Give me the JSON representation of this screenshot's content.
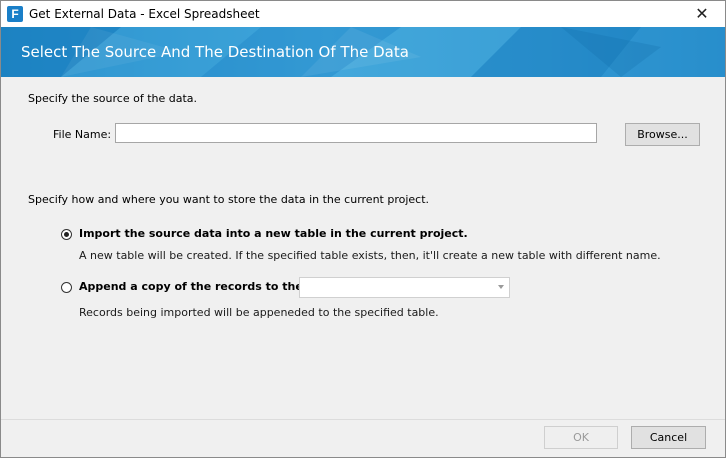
{
  "window": {
    "title": "Get External Data - Excel Spreadsheet",
    "app_icon_letter": "F",
    "close_glyph": "✕"
  },
  "banner": {
    "title": "Select The Source And The Destination Of The Data",
    "color": "#2a90cd"
  },
  "source": {
    "prompt": "Specify the source of the data.",
    "file_label": "File Name:",
    "file_value": "",
    "browse_label": "Browse..."
  },
  "destination": {
    "prompt": "Specify how and where you want to store the data in the current project.",
    "options": [
      {
        "label": "Import the source data into a new table in the current project.",
        "description": "A new table will be created. If the specified table exists, then, it'll create a new table with different name.",
        "selected": true
      },
      {
        "label": "Append a copy of the records to the table:",
        "description": "Records being imported will be appeneded to the specified table.",
        "selected": false,
        "table_value": ""
      }
    ]
  },
  "footer": {
    "ok_label": "OK",
    "ok_enabled": false,
    "cancel_label": "Cancel"
  }
}
